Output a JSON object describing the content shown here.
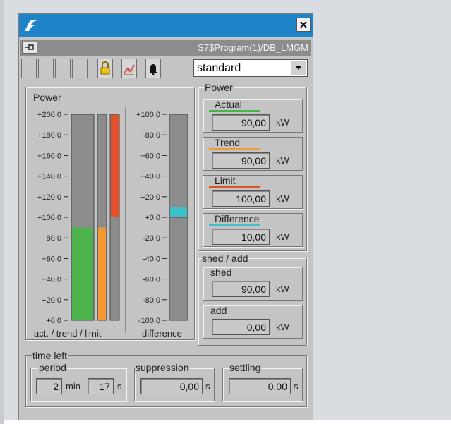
{
  "window": {
    "path": "S7$Program(1)/DB_LMGM",
    "close_label": "×"
  },
  "toolbar": {
    "mode_value": "standard"
  },
  "icons": {
    "title": "app-logo-icon",
    "pin": "pin-icon",
    "lock": "lock-icon",
    "chart": "chart-icon",
    "bell": "bell-icon",
    "dropdown": "chevron-down-icon"
  },
  "chart_panel": {
    "title": "Power",
    "left_ticks": [
      "+200,0",
      "+180,0",
      "+160,0",
      "+140,0",
      "+120,0",
      "+100,0",
      "+80,0",
      "+60,0",
      "+40,0",
      "+20,0",
      "+0,0"
    ],
    "right_ticks": [
      "+100,0",
      "+80,0",
      "+60,0",
      "+40,0",
      "+20,0",
      "+0,0",
      "-20,0",
      "-40,0",
      "-60,0",
      "-80,0",
      "-100,0"
    ],
    "left_caption": "act. / trend / limit",
    "right_caption": "difference"
  },
  "chart_data": [
    {
      "type": "bar",
      "categories": [
        "Actual",
        "Trend",
        "Limit"
      ],
      "values": [
        90,
        90,
        100
      ],
      "ylim": [
        0,
        200
      ],
      "colors": [
        "#4cb24c",
        "#f39a35",
        "#e2502a"
      ],
      "xlabel": "act. / trend / limit",
      "ylabel": "",
      "title": "Power"
    },
    {
      "type": "bar",
      "categories": [
        "Difference"
      ],
      "values": [
        10
      ],
      "ylim": [
        -100,
        100
      ],
      "colors": [
        "#3ec0c8"
      ],
      "xlabel": "difference",
      "ylabel": "",
      "title": ""
    }
  ],
  "power_values": {
    "title": "Power",
    "unit": "kW",
    "items": [
      {
        "label": "Actual",
        "value": "90,00",
        "color": "#4cb24c"
      },
      {
        "label": "Trend",
        "value": "90,00",
        "color": "#f39a35"
      },
      {
        "label": "Limit",
        "value": "100,00",
        "color": "#e2502a"
      },
      {
        "label": "Difference",
        "value": "10,00",
        "color": "#3ec0c8"
      }
    ]
  },
  "shed_add": {
    "title": "shed / add",
    "unit": "kW",
    "shed_label": "shed",
    "shed_value": "90,00",
    "add_label": "add",
    "add_value": "0,00"
  },
  "time_left": {
    "title": "time left",
    "period_label": "period",
    "period_min": "2",
    "min_unit": "min",
    "period_sec": "17",
    "sec_unit": "s",
    "suppression_label": "suppression",
    "suppression_value": "0,00",
    "settling_label": "settling",
    "settling_value": "0,00"
  }
}
